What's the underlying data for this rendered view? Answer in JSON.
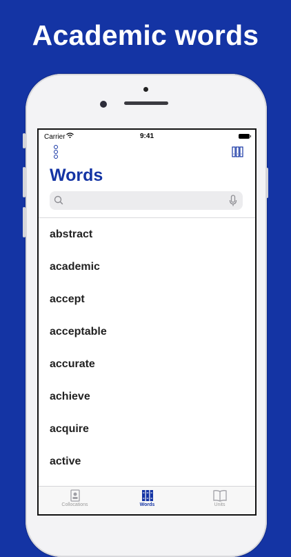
{
  "headline": "Academic words",
  "colors": {
    "brand_blue": "#1434a4",
    "background": "#1434a4"
  },
  "status_bar": {
    "carrier": "Carrier",
    "time": "9:41"
  },
  "toolbar": {
    "left_icon": "menu-dots-icon",
    "right_icon": "library-icon"
  },
  "page_title": "Words",
  "search": {
    "placeholder": "",
    "value": ""
  },
  "word_list": [
    "abstract",
    "academic",
    "accept",
    "acceptable",
    "accurate",
    "achieve",
    "acquire",
    "active"
  ],
  "tab_bar": {
    "tabs": [
      {
        "label": "Collocations",
        "icon": "collocations-icon",
        "active": false
      },
      {
        "label": "Words",
        "icon": "words-icon",
        "active": true
      },
      {
        "label": "Units",
        "icon": "units-book-icon",
        "active": false
      }
    ]
  }
}
